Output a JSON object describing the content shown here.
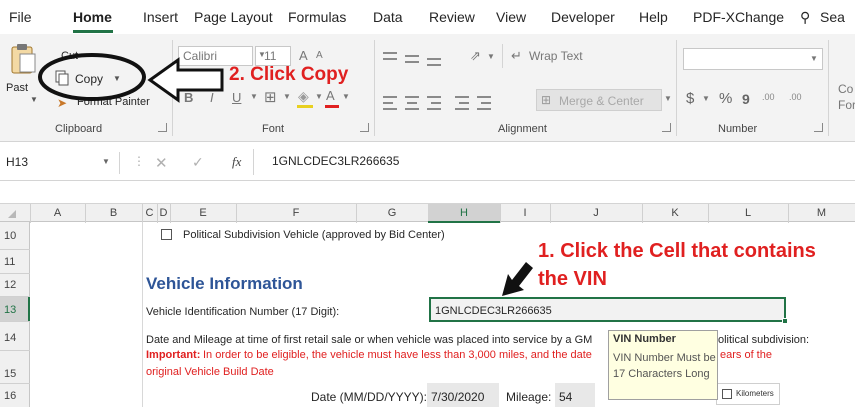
{
  "ribbon_tabs": [
    "File",
    "Home",
    "Insert",
    "Page Layout",
    "Formulas",
    "Data",
    "Review",
    "View",
    "Developer",
    "Help",
    "PDF-XChange",
    "Sea"
  ],
  "clipboard": {
    "paste_label": "Past",
    "cut_label": "Cut",
    "copy_label": "Copy",
    "format_painter_label": "Format Painter",
    "group_label": "Clipboard"
  },
  "font": {
    "font_name": "Calibri",
    "font_size": "11",
    "grow_label": "A",
    "shrink_label": "A",
    "bold": "B",
    "italic": "I",
    "underline": "U",
    "font_color_label": "A",
    "group_label": "Font"
  },
  "alignment": {
    "wrap_text_label": "Wrap Text",
    "merge_label": "Merge & Center",
    "group_label": "Alignment"
  },
  "number": {
    "format_value": "",
    "currency": "$",
    "percent": "%",
    "comma": "9",
    "inc_decimal": ".00",
    "dec_decimal": ".00",
    "group_label": "Number"
  },
  "styles_partial": {
    "line1": "Co",
    "line2": "For"
  },
  "formula_bar": {
    "name_box": "H13",
    "fx": "fx",
    "value": "1GNLCDEC3LR266635"
  },
  "columns": [
    "A",
    "B",
    "C",
    "D",
    "E",
    "F",
    "G",
    "H",
    "I",
    "J",
    "K",
    "L",
    "M"
  ],
  "rows": [
    "10",
    "11",
    "12",
    "13",
    "14",
    "15",
    "16"
  ],
  "sheet": {
    "political_checkbox_label": "Political Subdivision Vehicle (approved by Bid Center)",
    "section_title": "Vehicle Information",
    "vin_label": "Vehicle Identification Number (17 Digit):",
    "vin_value": "1GNLCDEC3LR266635",
    "date_mileage_text": "Date and Mileage at time of first retail sale or when vehicle was placed into service by a GM",
    "political_tail": "olitical subdivision:",
    "important_label": "Important:",
    "important_text": "In order to be eligible, the vehicle must have less than 3,000 miles, and the date",
    "years_tail": "ears of the",
    "build_date_text": "original Vehicle Build Date",
    "date_label": "Date (MM/DD/YYYY):",
    "date_value": "7/30/2020",
    "mileage_label": "Mileage:",
    "mileage_value": "54",
    "kilometers_label": "Kilometers"
  },
  "tooltip": {
    "title": "VIN Number",
    "body": "VIN Number Must be 17 Characters Long"
  },
  "annotations": {
    "step2": "2. Click Copy",
    "step1_line1": "1. Click the Cell that contains",
    "step1_line2": "the VIN"
  },
  "colors": {
    "excel_green": "#217346",
    "annotation_red": "#e02020",
    "section_blue": "#2e5597",
    "tooltip_bg": "#ffffe1"
  }
}
